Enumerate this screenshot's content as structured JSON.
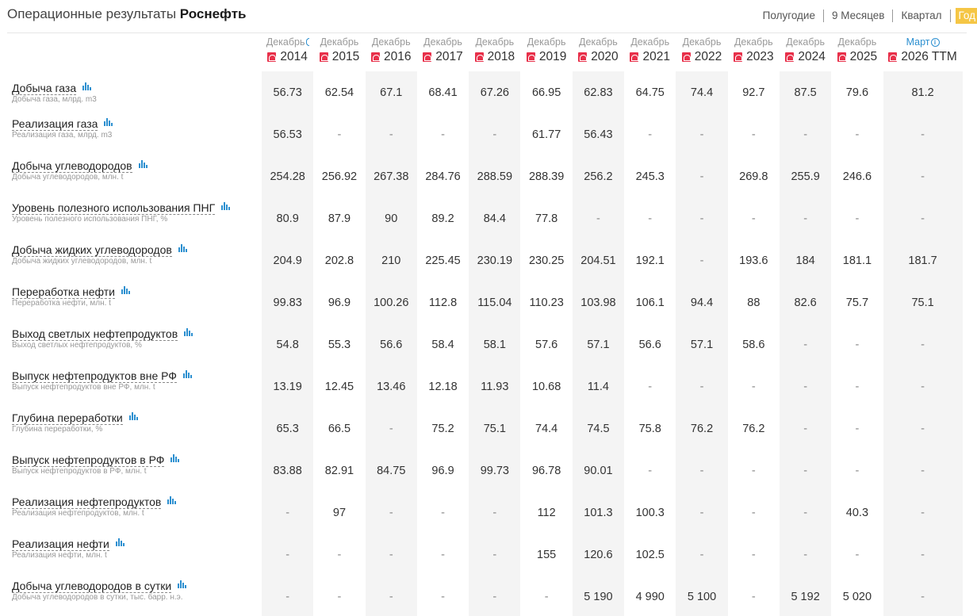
{
  "header": {
    "title_prefix": "Операционные результаты",
    "company": "Роснефть",
    "periods": [
      "Полугодие",
      "9 Месяцев",
      "Квартал",
      "Год"
    ],
    "active_period": "Год"
  },
  "columns": [
    {
      "month": "Декабрь",
      "year": "2014"
    },
    {
      "month": "Декабрь",
      "year": "2015"
    },
    {
      "month": "Декабрь",
      "year": "2016"
    },
    {
      "month": "Декабрь",
      "year": "2017"
    },
    {
      "month": "Декабрь",
      "year": "2018"
    },
    {
      "month": "Декабрь",
      "year": "2019"
    },
    {
      "month": "Декабрь",
      "year": "2020"
    },
    {
      "month": "Декабрь",
      "year": "2021"
    },
    {
      "month": "Декабрь",
      "year": "2022"
    },
    {
      "month": "Декабрь",
      "year": "2023"
    },
    {
      "month": "Декабрь",
      "year": "2024"
    },
    {
      "month": "Декабрь",
      "year": "2025"
    },
    {
      "month": "Март",
      "year": "2026 TTM"
    }
  ],
  "rows": [
    {
      "name": "Добыча газа",
      "sub": "Добыча газа, млрд. m3",
      "values": [
        "56.73",
        "62.54",
        "67.1",
        "68.41",
        "67.26",
        "66.95",
        "62.83",
        "64.75",
        "74.4",
        "92.7",
        "87.5",
        "79.6",
        "81.2"
      ]
    },
    {
      "name": "Реализация газа",
      "sub": "Реализация газа, млрд. m3",
      "values": [
        "56.53",
        "-",
        "-",
        "-",
        "-",
        "61.77",
        "56.43",
        "-",
        "-",
        "-",
        "-",
        "-",
        "-"
      ]
    },
    {
      "name": "Добыча углеводородов",
      "sub": "Добыча углеводородов, млн. t",
      "values": [
        "254.28",
        "256.92",
        "267.38",
        "284.76",
        "288.59",
        "288.39",
        "256.2",
        "245.3",
        "-",
        "269.8",
        "255.9",
        "246.6",
        "-"
      ]
    },
    {
      "name": "Уровень полезного использования ПНГ",
      "sub": "Уровень полезного использования ПНГ, %",
      "values": [
        "80.9",
        "87.9",
        "90",
        "89.2",
        "84.4",
        "77.8",
        "-",
        "-",
        "-",
        "-",
        "-",
        "-",
        "-"
      ]
    },
    {
      "name": "Добыча жидких углеводородов",
      "sub": "Добыча жидких углеводородов, млн. t",
      "values": [
        "204.9",
        "202.8",
        "210",
        "225.45",
        "230.19",
        "230.25",
        "204.51",
        "192.1",
        "-",
        "193.6",
        "184",
        "181.1",
        "181.7"
      ]
    },
    {
      "name": "Переработка нефти",
      "sub": "Переработка нефти, млн. t",
      "values": [
        "99.83",
        "96.9",
        "100.26",
        "112.8",
        "115.04",
        "110.23",
        "103.98",
        "106.1",
        "94.4",
        "88",
        "82.6",
        "75.7",
        "75.1"
      ]
    },
    {
      "name": "Выход светлых нефтепродуктов",
      "sub": "Выход светлых нефтепродуктов, %",
      "values": [
        "54.8",
        "55.3",
        "56.6",
        "58.4",
        "58.1",
        "57.6",
        "57.1",
        "56.6",
        "57.1",
        "58.6",
        "-",
        "-",
        "-"
      ]
    },
    {
      "name": "Выпуск нефтепродуктов вне РФ",
      "sub": "Выпуск нефтепродуктов вне РФ, млн. t",
      "values": [
        "13.19",
        "12.45",
        "13.46",
        "12.18",
        "11.93",
        "10.68",
        "11.4",
        "-",
        "-",
        "-",
        "-",
        "-",
        "-"
      ]
    },
    {
      "name": "Глубина переработки",
      "sub": "Глубина переработки, %",
      "values": [
        "65.3",
        "66.5",
        "-",
        "75.2",
        "75.1",
        "74.4",
        "74.5",
        "75.8",
        "76.2",
        "76.2",
        "-",
        "-",
        "-"
      ]
    },
    {
      "name": "Выпуск нефтепродуктов в РФ",
      "sub": "Выпуск нефтепродуктов в РФ, млн. t",
      "values": [
        "83.88",
        "82.91",
        "84.75",
        "96.9",
        "99.73",
        "96.78",
        "90.01",
        "-",
        "-",
        "-",
        "-",
        "-",
        "-"
      ]
    },
    {
      "name": "Реализация нефтепродуктов",
      "sub": "Реализация нефтепродуктов, млн. t",
      "values": [
        "-",
        "97",
        "-",
        "-",
        "-",
        "112",
        "101.3",
        "100.3",
        "-",
        "-",
        "-",
        "40.3",
        "-"
      ]
    },
    {
      "name": "Реализация нефти",
      "sub": "Реализация нефти, млн. t",
      "values": [
        "-",
        "-",
        "-",
        "-",
        "-",
        "155",
        "120.6",
        "102.5",
        "-",
        "-",
        "-",
        "-",
        "-"
      ]
    },
    {
      "name": "Добыча углеводородов в сутки",
      "sub": "Добыча углеводородов в сутки, тыс. барр. н.э.",
      "values": [
        "-",
        "-",
        "-",
        "-",
        "-",
        "-",
        "5 190",
        "4 990",
        "5 100",
        "-",
        "5 192",
        "5 020",
        "-"
      ]
    }
  ],
  "icons": {
    "pdf": "pdf-icon",
    "chart": "bar-chart-icon",
    "info": "info-icon"
  },
  "colors": {
    "accent": "#2b8fd0",
    "pdf": "#e8304a",
    "active_tab": "#f5c645",
    "shade": "#f4f4f4"
  }
}
